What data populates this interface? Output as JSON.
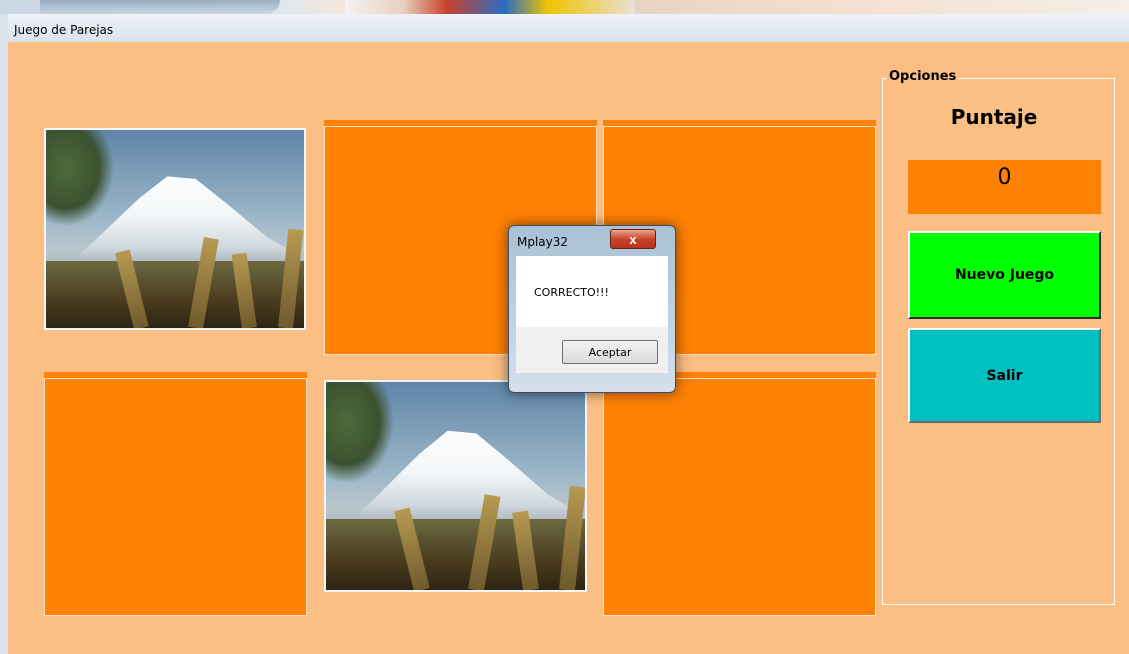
{
  "window": {
    "title": "Juego de Parejas"
  },
  "panel": {
    "legend": "Opciones",
    "score_label": "Puntaje",
    "score_value": "0",
    "new_game_label": "Nuevo Juego",
    "exit_label": "Salir"
  },
  "board": {
    "cards": [
      {
        "state": "revealed",
        "image": "volcano-picture"
      },
      {
        "state": "hidden"
      },
      {
        "state": "hidden"
      },
      {
        "state": "hidden"
      },
      {
        "state": "revealed",
        "image": "volcano-picture"
      },
      {
        "state": "hidden"
      }
    ]
  },
  "dialog": {
    "title": "Mplay32",
    "message": "CORRECTO!!!",
    "ok_label": "Aceptar",
    "close_glyph": "x"
  },
  "colors": {
    "background": "#fbbf83",
    "card_back": "#ff8105",
    "new_game_button": "#00ff00",
    "exit_button": "#00c0c0"
  }
}
